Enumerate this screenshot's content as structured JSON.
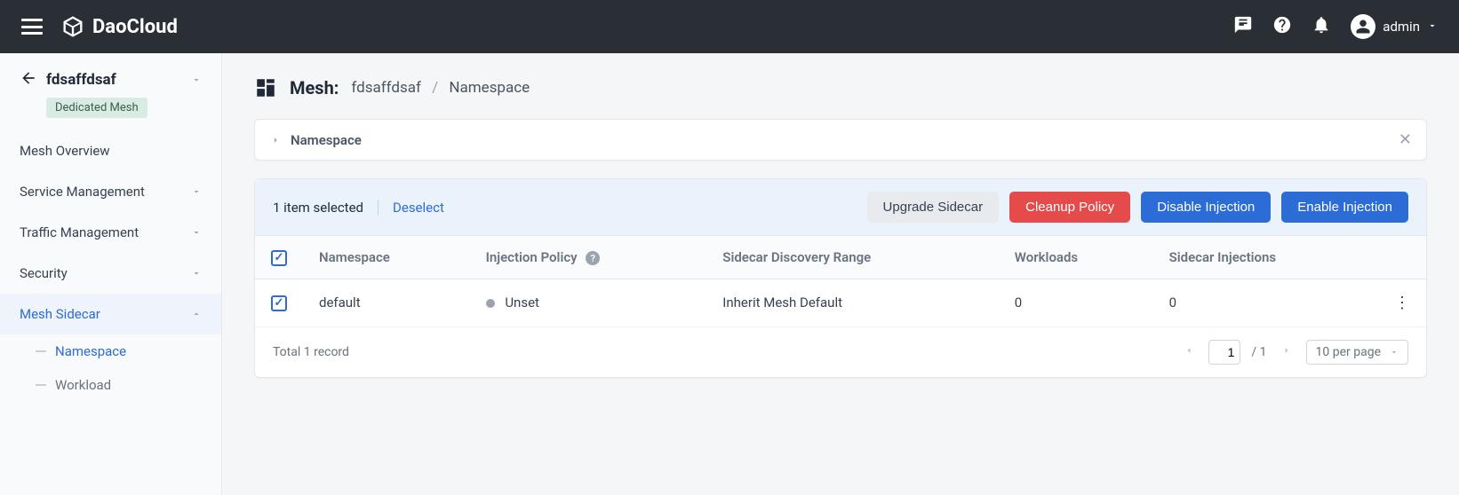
{
  "topbar": {
    "brand": "DaoCloud",
    "user": "admin"
  },
  "sidebar": {
    "mesh_name": "fdsaffdsaf",
    "badge": "Dedicated Mesh",
    "items": [
      {
        "label": "Mesh Overview",
        "expandable": false
      },
      {
        "label": "Service Management",
        "expandable": true
      },
      {
        "label": "Traffic Management",
        "expandable": true
      },
      {
        "label": "Security",
        "expandable": true
      },
      {
        "label": "Mesh Sidecar",
        "expandable": true,
        "active": true
      }
    ],
    "subitems": [
      {
        "label": "Namespace",
        "active": true
      },
      {
        "label": "Workload",
        "active": false
      }
    ]
  },
  "header": {
    "prefix": "Mesh:",
    "crumb1": "fdsaffdsaf",
    "crumb2": "Namespace"
  },
  "panel": {
    "title": "Namespace"
  },
  "selection": {
    "text": "1 item selected",
    "deselect": "Deselect",
    "buttons": {
      "upgrade": "Upgrade Sidecar",
      "cleanup": "Cleanup Policy",
      "disable": "Disable Injection",
      "enable": "Enable Injection"
    }
  },
  "table": {
    "headers": {
      "namespace": "Namespace",
      "injection": "Injection Policy",
      "discovery": "Sidecar Discovery Range",
      "workloads": "Workloads",
      "sidecar_inj": "Sidecar Injections"
    },
    "rows": [
      {
        "namespace": "default",
        "injection": "Unset",
        "discovery": "Inherit Mesh Default",
        "workloads": "0",
        "sidecar_inj": "0"
      }
    ],
    "footer": {
      "total": "Total 1 record",
      "page_current": "1",
      "page_sep": "/ 1",
      "per_page": "10 per page"
    }
  }
}
